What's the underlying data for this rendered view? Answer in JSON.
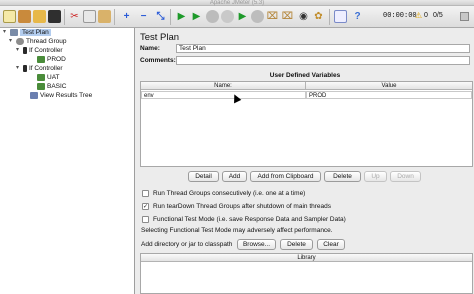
{
  "window": {
    "title": "Apache JMeter (5.3)"
  },
  "toolbar": {
    "timer": "00:00:00",
    "warnings": "0",
    "threads": "0/5",
    "icons": [
      "new-icon",
      "templates-icon",
      "open-icon",
      "save-icon",
      "cut-icon",
      "copy-icon",
      "paste-icon",
      "expand-icon",
      "collapse-icon",
      "toggle-icon",
      "start-icon",
      "start-no-pause-icon",
      "stop-icon",
      "shutdown-icon",
      "remote-start-icon",
      "remote-stop-icon",
      "clear-icon",
      "clear-all-icon",
      "search-icon",
      "reset-search-icon",
      "function-helper-icon",
      "help-icon"
    ]
  },
  "tree": {
    "items": [
      {
        "label": "Test Plan",
        "selected": true
      },
      {
        "label": "Thread Group"
      },
      {
        "label": "If Controller"
      },
      {
        "label": "PROD"
      },
      {
        "label": "If Controller"
      },
      {
        "label": "UAT"
      },
      {
        "label": "BASIC"
      },
      {
        "label": "View Results Tree"
      }
    ]
  },
  "panel": {
    "title": "Test Plan",
    "name_label": "Name:",
    "name_value": "Test Plan",
    "comments_label": "Comments:",
    "comments_value": "",
    "variables_title": "User Defined Variables",
    "columns": [
      "Name:",
      "Value"
    ],
    "rows": [
      {
        "name": "env",
        "value": "PROD"
      }
    ],
    "buttons": {
      "detail": "Detail",
      "add": "Add",
      "add_clipboard": "Add from Clipboard",
      "delete": "Delete",
      "up": "Up",
      "down": "Down"
    },
    "options": [
      {
        "label": "Run Thread Groups consecutively (i.e. one at a time)",
        "checked": false
      },
      {
        "label": "Run tearDown Thread Groups after shutdown of main threads",
        "checked": true
      },
      {
        "label": "Functional Test Mode (i.e. save Response Data and Sampler Data)",
        "checked": false
      }
    ],
    "functional_note": "Selecting Functional Test Mode may adversely affect performance.",
    "classpath_label": "Add directory or jar to classpath",
    "classpath_buttons": {
      "browse": "Browse...",
      "delete": "Delete",
      "clear": "Clear"
    },
    "library_column": "Library"
  }
}
